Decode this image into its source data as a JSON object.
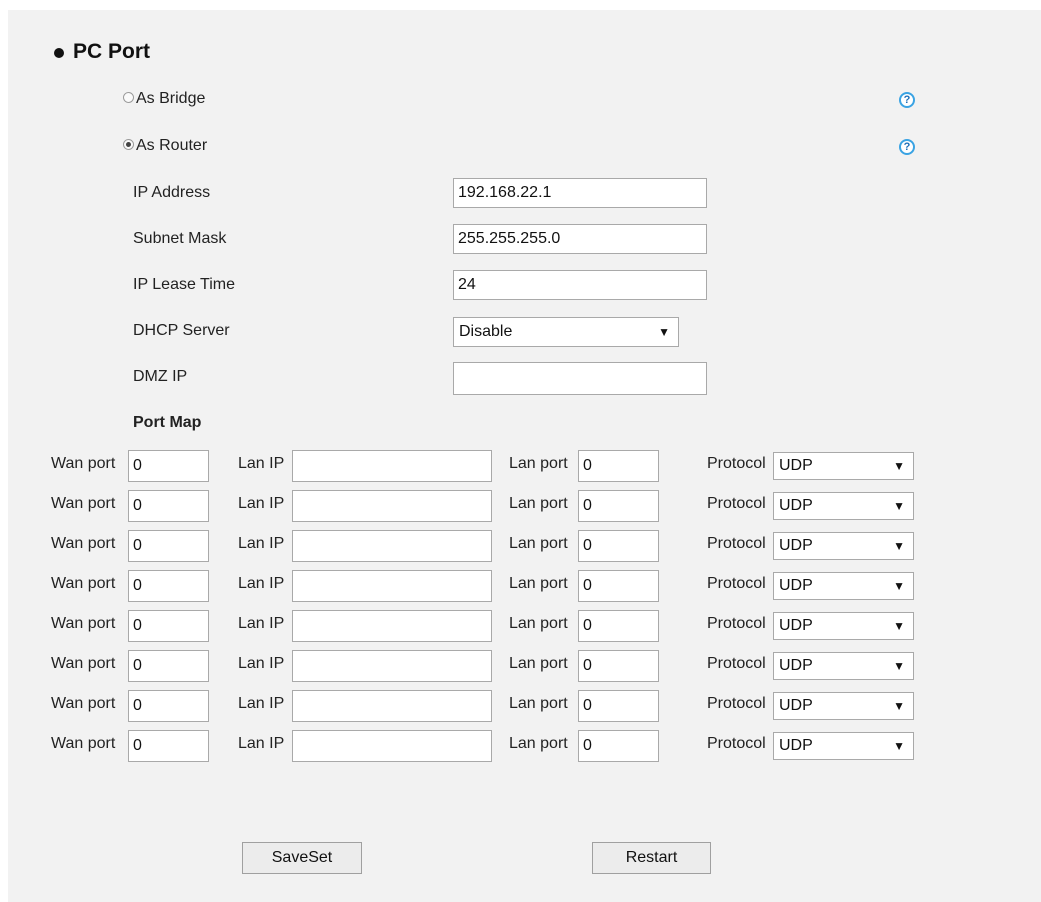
{
  "section": {
    "title": "PC Port"
  },
  "mode": {
    "bridge_label": "As Bridge",
    "router_label": "As Router",
    "selected": "router",
    "help_glyph": "?"
  },
  "form": {
    "ip_label": "IP Address",
    "ip_value": "192.168.22.1",
    "mask_label": "Subnet Mask",
    "mask_value": "255.255.255.0",
    "lease_label": "IP Lease Time",
    "lease_value": "24",
    "dhcp_label": "DHCP Server",
    "dhcp_value": "Disable",
    "dmz_label": "DMZ IP",
    "dmz_value": ""
  },
  "portmap": {
    "title": "Port Map",
    "wan_label": "Wan port",
    "lanip_label": "Lan IP",
    "lanport_label": "Lan port",
    "protocol_label": "Protocol",
    "rows": [
      {
        "wan_port": "0",
        "lan_ip": "",
        "lan_port": "0",
        "protocol": "UDP"
      },
      {
        "wan_port": "0",
        "lan_ip": "",
        "lan_port": "0",
        "protocol": "UDP"
      },
      {
        "wan_port": "0",
        "lan_ip": "",
        "lan_port": "0",
        "protocol": "UDP"
      },
      {
        "wan_port": "0",
        "lan_ip": "",
        "lan_port": "0",
        "protocol": "UDP"
      },
      {
        "wan_port": "0",
        "lan_ip": "",
        "lan_port": "0",
        "protocol": "UDP"
      },
      {
        "wan_port": "0",
        "lan_ip": "",
        "lan_port": "0",
        "protocol": "UDP"
      },
      {
        "wan_port": "0",
        "lan_ip": "",
        "lan_port": "0",
        "protocol": "UDP"
      },
      {
        "wan_port": "0",
        "lan_ip": "",
        "lan_port": "0",
        "protocol": "UDP"
      }
    ]
  },
  "buttons": {
    "save": "SaveSet",
    "restart": "Restart"
  },
  "icons": {
    "dropdown": "▼"
  },
  "colors": {
    "background": "#f2f2f2",
    "help_accent": "#3aa3e3"
  }
}
